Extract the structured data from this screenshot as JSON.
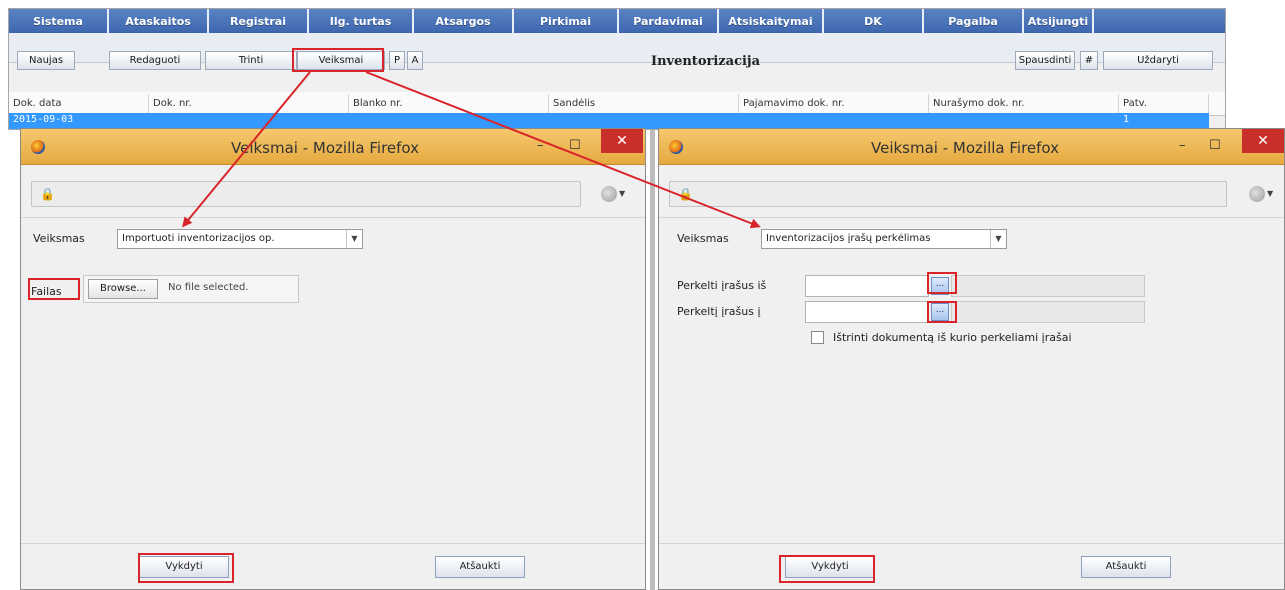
{
  "menu": [
    "Sistema",
    "Ataskaitos",
    "Registrai",
    "Ilg. turtas",
    "Atsargos",
    "Pirkimai",
    "Pardavimai",
    "Atsiskaitymai",
    "DK",
    "Pagalba",
    "Atsijungti"
  ],
  "toolbar": {
    "new": "Naujas",
    "edit": "Redaguoti",
    "delete": "Trinti",
    "actions": "Veiksmai",
    "p": "P",
    "a": "A",
    "title": "Inventorizacija",
    "print": "Spausdinti",
    "hash": "#",
    "close": "Uždaryti"
  },
  "grid": {
    "columns": [
      "Dok. data",
      "Dok. nr.",
      "Blanko nr.",
      "Sandėlis",
      "Pajamavimo dok. nr.",
      "Nurašymo dok. nr.",
      "Patv."
    ],
    "row": {
      "date": "2015-09-03",
      "patv": "1"
    }
  },
  "dialog_left": {
    "title": "Veiksmai - Mozilla Firefox",
    "action_label": "Veiksmas",
    "action_value": "Importuoti inventorizacijos op.",
    "file_label": "Failas",
    "browse": "Browse...",
    "no_file": "No file selected.",
    "ok": "Vykdyti",
    "cancel": "Atšaukti"
  },
  "dialog_right": {
    "title": "Veiksmai - Mozilla Firefox",
    "action_label": "Veiksmas",
    "action_value": "Inventorizacijos įrašų perkėlimas",
    "move_from": "Perkelti įrašus iš",
    "move_to": "Perkeltį įrašus į",
    "dots": "...",
    "delete_doc": "Ištrinti dokumentą iš kurio perkeliami įrašai",
    "ok": "Vykdyti",
    "cancel": "Atšaukti"
  },
  "colors": {
    "menu_bg": "#4a73b8",
    "title_bar": "#eeb958",
    "highlight": "#d9242a",
    "selection": "#3399ff",
    "close_button": "#c9302c"
  },
  "icons": [
    "firefox-icon",
    "lock-icon",
    "globe-icon",
    "minimize-icon",
    "maximize-icon",
    "close-icon",
    "chevron-down-icon"
  ]
}
